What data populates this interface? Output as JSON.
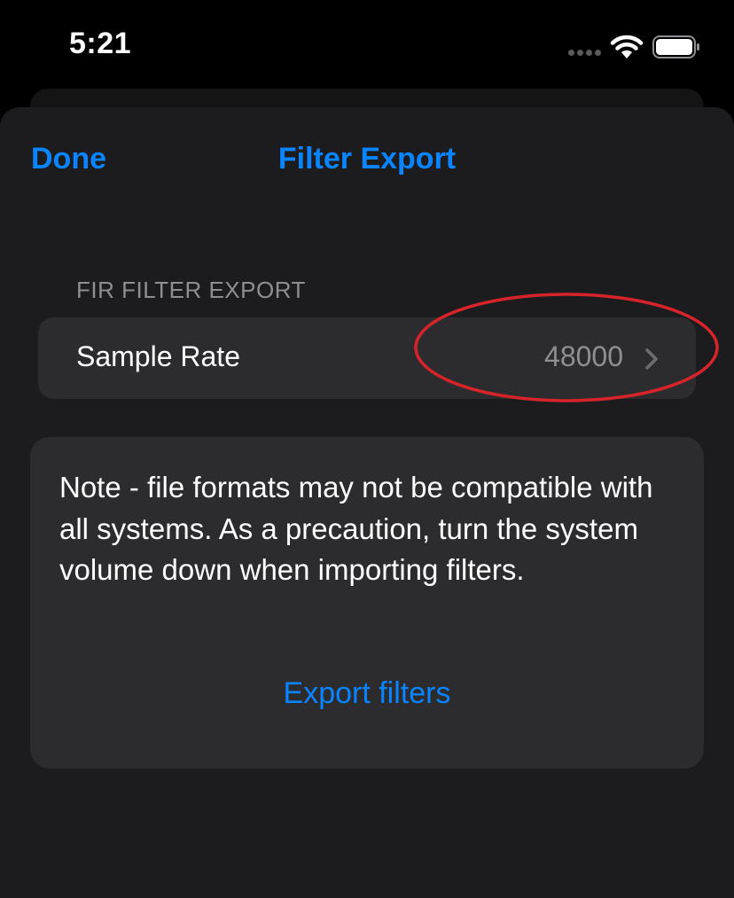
{
  "status_bar": {
    "time": "5:21"
  },
  "nav": {
    "done_label": "Done",
    "title": "Filter Export"
  },
  "section": {
    "header": "FIR FILTER EXPORT",
    "sample_rate": {
      "label": "Sample Rate",
      "value": "48000"
    }
  },
  "note": {
    "text": "Note - file formats may not be compatible with all systems. As a precaution, turn the system volume down when importing filters."
  },
  "export": {
    "label": "Export filters"
  },
  "icons": {
    "wifi": "wifi-icon",
    "battery": "battery-icon",
    "signal": "cellular-signal-icon",
    "chevron": "chevron-right-icon"
  },
  "colors": {
    "accent": "#0a84ff",
    "background": "#1c1c1e",
    "cell": "#2c2c2e",
    "secondary_text": "#8e8e93",
    "annotation": "#d7232a"
  }
}
